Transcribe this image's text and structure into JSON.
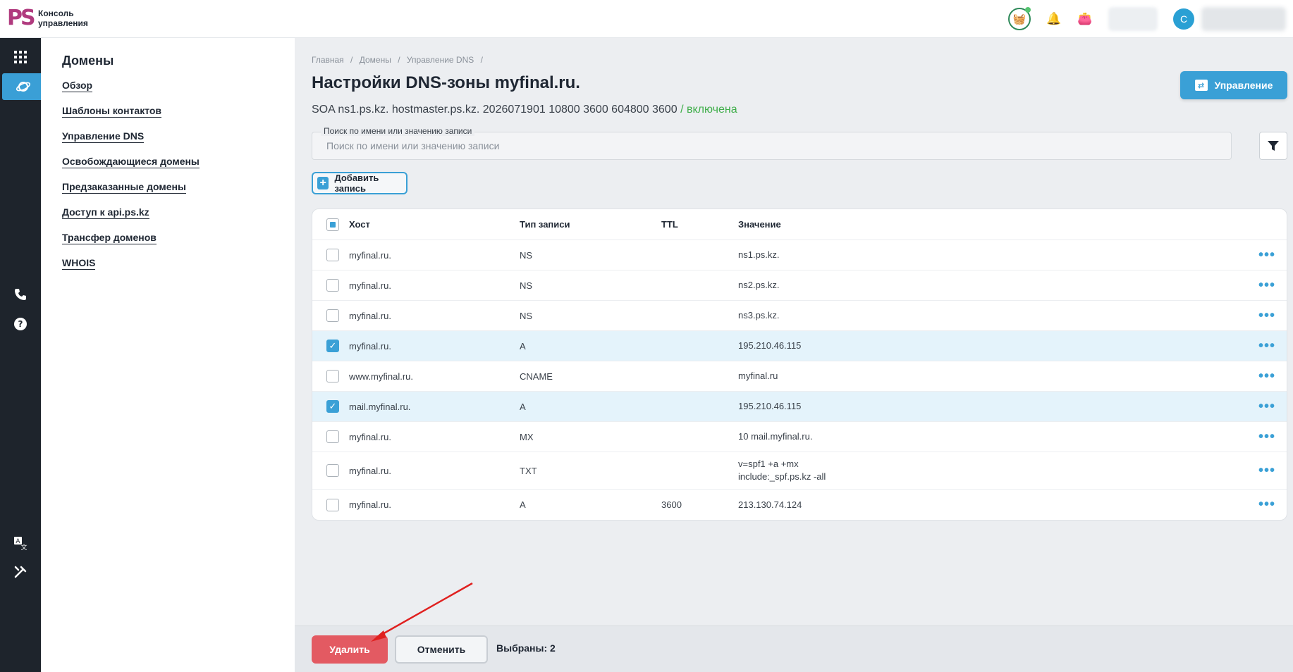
{
  "app": {
    "logo_mark": "PS",
    "logo_text": "Консоль управления",
    "avatar_letter": "С",
    "accent": "#3aa0d6",
    "danger": "#e35a62",
    "success": "#3fae4a"
  },
  "sidebar": {
    "title": "Домены",
    "items": [
      {
        "label": "Обзор"
      },
      {
        "label": "Шаблоны контактов"
      },
      {
        "label": "Управление DNS"
      },
      {
        "label": "Освобождающиеся домены"
      },
      {
        "label": "Предзаказанные домены"
      },
      {
        "label": "Доступ к api.ps.kz"
      },
      {
        "label": "Трансфер доменов"
      },
      {
        "label": "WHOIS"
      }
    ]
  },
  "breadcrumb": [
    "Главная",
    "/",
    "Домены",
    "/",
    "Управление DNS",
    "/"
  ],
  "page": {
    "title": "Настройки DNS-зоны myfinal.ru.",
    "soa": "SOA ns1.ps.kz. hostmaster.ps.kz. 2026071901 10800 3600 604800 3600",
    "soa_sep": "/",
    "soa_status": "включена",
    "manage_label": "Управление"
  },
  "search": {
    "label": "Поиск по имени или значению записи",
    "placeholder": "Поиск по имени или значению записи"
  },
  "add_button": "Добавить запись",
  "table": {
    "headers": {
      "host": "Хост",
      "type": "Тип записи",
      "ttl": "TTL",
      "value": "Значение"
    },
    "rows": [
      {
        "host": "myfinal.ru.",
        "type": "NS",
        "ttl": "",
        "value": "ns1.ps.kz.",
        "checked": false
      },
      {
        "host": "myfinal.ru.",
        "type": "NS",
        "ttl": "",
        "value": "ns2.ps.kz.",
        "checked": false
      },
      {
        "host": "myfinal.ru.",
        "type": "NS",
        "ttl": "",
        "value": "ns3.ps.kz.",
        "checked": false
      },
      {
        "host": "myfinal.ru.",
        "type": "A",
        "ttl": "",
        "value": "195.210.46.115",
        "checked": true
      },
      {
        "host": "www.myfinal.ru.",
        "type": "CNAME",
        "ttl": "",
        "value": "myfinal.ru",
        "checked": false
      },
      {
        "host": "mail.myfinal.ru.",
        "type": "A",
        "ttl": "",
        "value": "195.210.46.115",
        "checked": true
      },
      {
        "host": "myfinal.ru.",
        "type": "MX",
        "ttl": "",
        "value": "10 mail.myfinal.ru.",
        "checked": false
      },
      {
        "host": "myfinal.ru.",
        "type": "TXT",
        "ttl": "",
        "value": "v=spf1 +a +mx include:_spf.ps.kz -all",
        "checked": false
      },
      {
        "host": "myfinal.ru.",
        "type": "A",
        "ttl": "3600",
        "value": "213.130.74.124",
        "checked": false
      }
    ],
    "row_menu_glyph": "•••"
  },
  "actions": {
    "delete": "Удалить",
    "cancel": "Отменить",
    "selected": "Выбраны: 2"
  }
}
